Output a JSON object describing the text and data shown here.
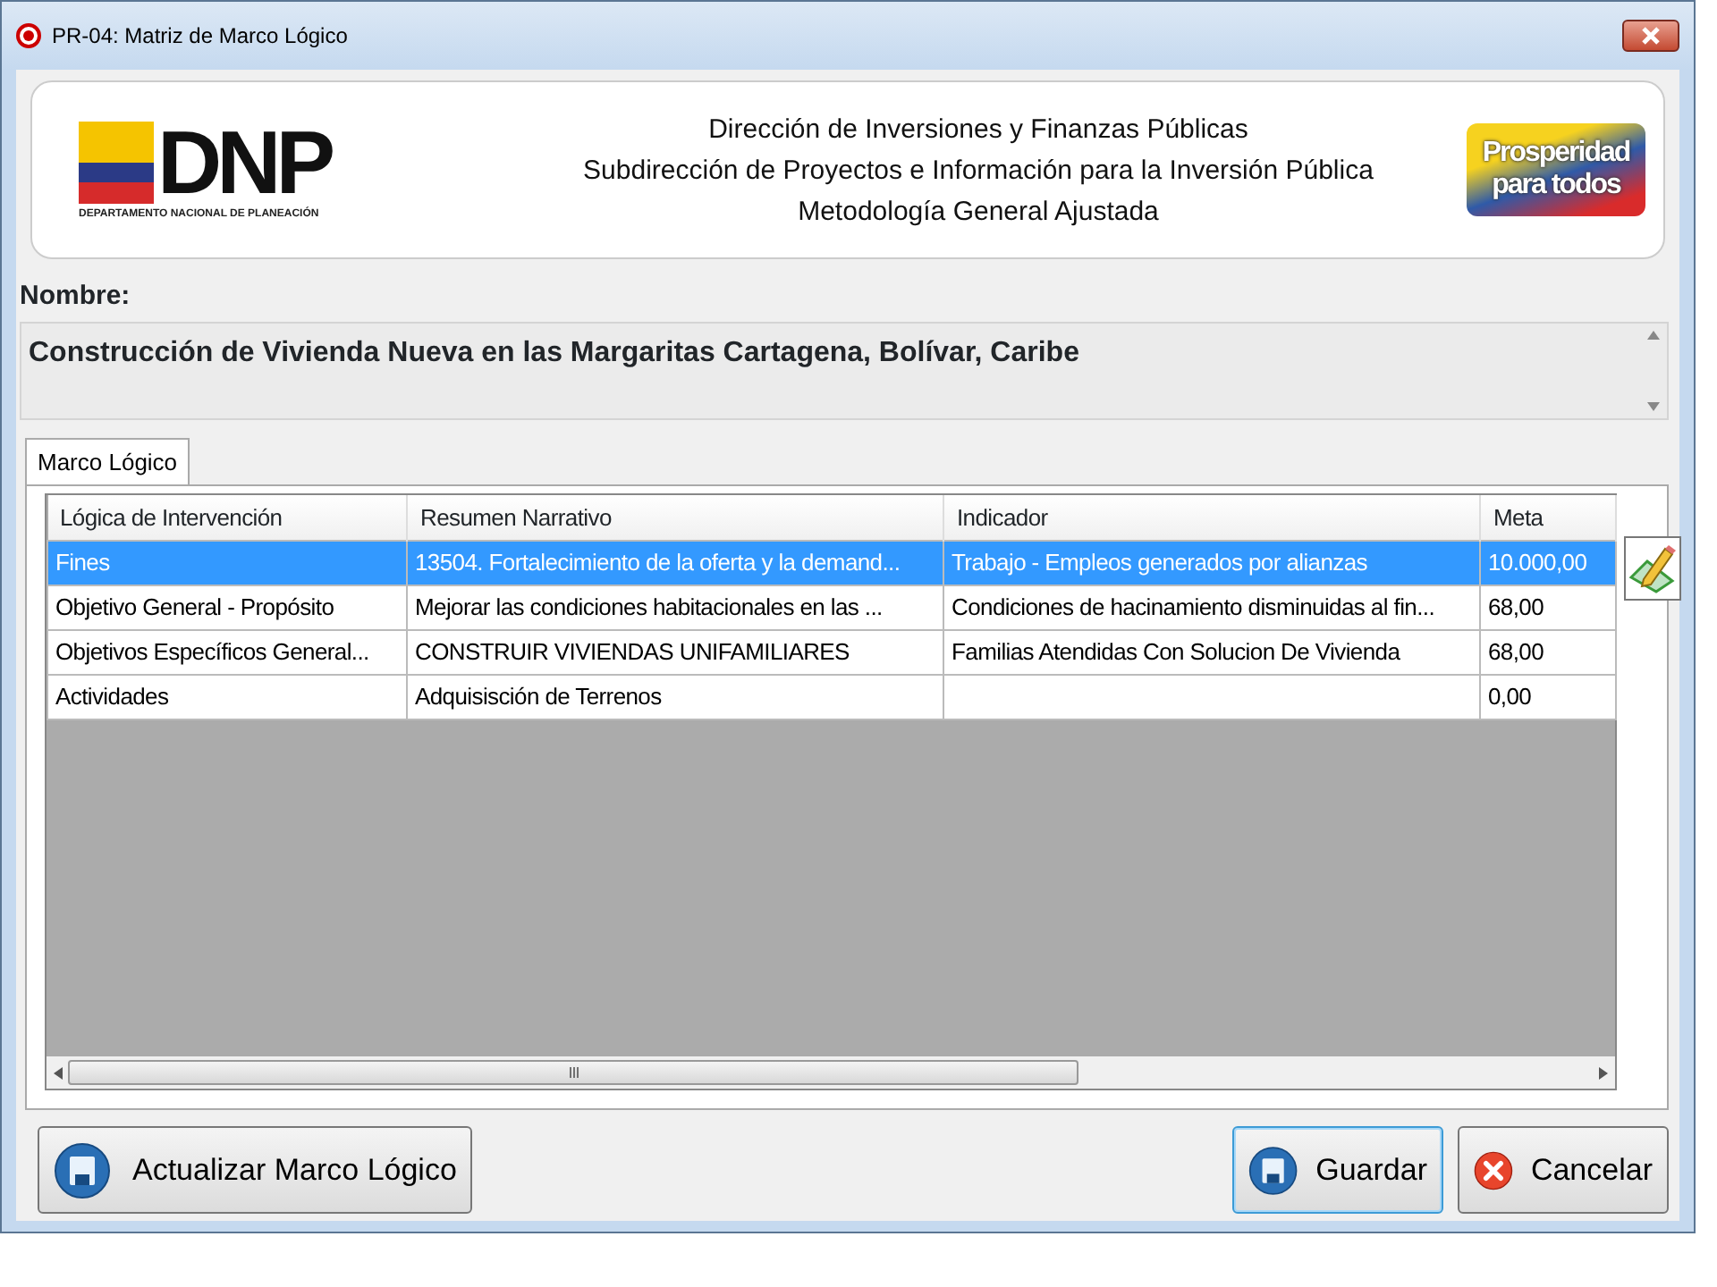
{
  "window": {
    "title": "PR-04: Matriz de Marco Lógico"
  },
  "header": {
    "logo_text": "DNP",
    "logo_subtitle": "DEPARTAMENTO NACIONAL DE PLANEACIÓN",
    "lines": [
      "Dirección de Inversiones y Finanzas Públicas",
      "Subdirección de Proyectos e Información para la Inversión Pública",
      "Metodología General Ajustada"
    ],
    "slogan": [
      "Prosperidad",
      "para todos"
    ]
  },
  "name": {
    "label": "Nombre:",
    "value": "Construcción de Vivienda Nueva en las Margaritas Cartagena, Bolívar, Caribe"
  },
  "tabs": [
    {
      "label": "Marco Lógico",
      "selected": true
    }
  ],
  "table": {
    "columns": [
      "Lógica de Intervención",
      "Resumen Narrativo",
      "Indicador",
      "Meta"
    ],
    "rows": [
      {
        "selected": true,
        "cells": [
          "Fines",
          "13504. Fortalecimiento de la oferta y la demand...",
          "Trabajo - Empleos generados por alianzas",
          "10.000,00"
        ]
      },
      {
        "selected": false,
        "cells": [
          "Objetivo General - Propósito",
          "Mejorar las condiciones habitacionales en las ...",
          "Condiciones de hacinamiento disminuidas al fin...",
          "68,00"
        ]
      },
      {
        "selected": false,
        "cells": [
          "Objetivos Específicos General...",
          "CONSTRUIR VIVIENDAS UNIFAMILIARES",
          "Familias Atendidas Con Solucion De Vivienda",
          "68,00"
        ]
      },
      {
        "selected": false,
        "cells": [
          "Actividades",
          "Adquisisción de Terrenos",
          "",
          "0,00"
        ]
      }
    ]
  },
  "buttons": [
    {
      "kind": "save",
      "label": "Actualizar Marco Lógico",
      "focused": false
    },
    {
      "kind": "save",
      "label": "Guardar",
      "focused": true
    },
    {
      "kind": "cancel",
      "label": "Cancelar",
      "focused": false
    }
  ]
}
